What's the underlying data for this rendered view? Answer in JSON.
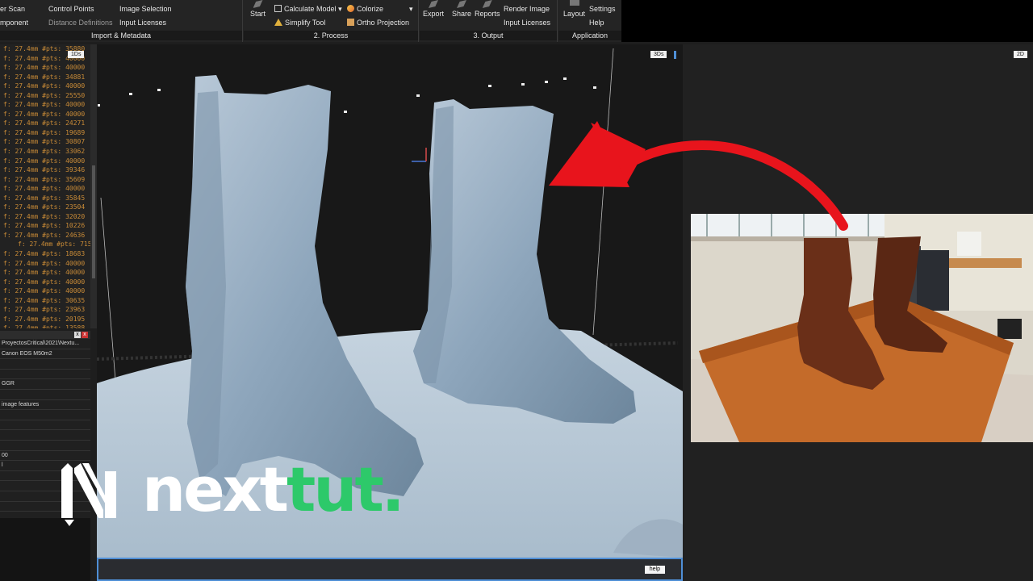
{
  "ribbon": {
    "import": {
      "title": "Import & Metadata",
      "items": [
        "er Scan",
        "Control Points",
        "Image Selection",
        "mponent",
        "Distance Definitions",
        "Input Licenses"
      ]
    },
    "process": {
      "title": "2. Process",
      "start": "Start",
      "calculate_model": "Calculate Model",
      "colorize": "Colorize",
      "simplify_tool": "Simplify Tool",
      "ortho_projection": "Ortho Projection"
    },
    "output": {
      "title": "3. Output",
      "export": "Export",
      "share": "Share",
      "reports": "Reports",
      "render_image": "Render Image",
      "input_licenses": "Input Licenses"
    },
    "application": {
      "title": "Application",
      "layout": "Layout",
      "settings": "Settings",
      "help": "Help"
    }
  },
  "log": {
    "chip": "1Ds",
    "lines": [
      "f: 27.4mm #pts: 35880",
      "f: 27.4mm #pts: 40000",
      "f: 27.4mm #pts: 40000",
      "f: 27.4mm #pts: 34881",
      "f: 27.4mm #pts: 40000",
      "f: 27.4mm #pts: 25550",
      "f: 27.4mm #pts: 40000",
      "f: 27.4mm #pts: 40000",
      "f: 27.4mm #pts: 24271",
      "f: 27.4mm #pts: 19689",
      "f: 27.4mm #pts: 30807",
      "f: 27.4mm #pts: 33062",
      "f: 27.4mm #pts: 40000",
      "f: 27.4mm #pts: 39346",
      "f: 27.4mm #pts: 35609",
      "f: 27.4mm #pts: 40000",
      "f: 27.4mm #pts: 35845",
      "f: 27.4mm #pts: 23504",
      "f: 27.4mm #pts: 32020",
      "f: 27.4mm #pts: 10226",
      "f: 27.4mm #pts: 24636",
      "f: 27.4mm #pts: 7155",
      "f: 27.4mm #pts: 18683",
      "f: 27.4mm #pts: 40000",
      "f: 27.4mm #pts: 40000",
      "f: 27.4mm #pts: 40000",
      "f: 27.4mm #pts: 40000",
      "f: 27.4mm #pts: 30635",
      "f: 27.4mm #pts: 23963",
      "f: 27.4mm #pts: 20195",
      "f: 27.4mm #pts: 13588"
    ]
  },
  "props": {
    "rows": [
      "ProyectosCritical\\2021\\Nextu...",
      "Canon EOS M50m2",
      "",
      "",
      "GGR",
      "",
      "image features",
      "",
      "",
      "",
      "",
      "00",
      "l",
      "",
      "",
      "",
      "",
      ""
    ]
  },
  "viewport": {
    "view3d_tag": "3Ds",
    "view2d_tag": "2D",
    "help_label": "help"
  },
  "logo": {
    "part1": "next",
    "part2": "tut."
  },
  "colors": {
    "accent_blue": "#4f8fd6",
    "log_orange": "#c98b37",
    "brand_green": "#2dc96a",
    "arrow_red": "#e8141c"
  }
}
